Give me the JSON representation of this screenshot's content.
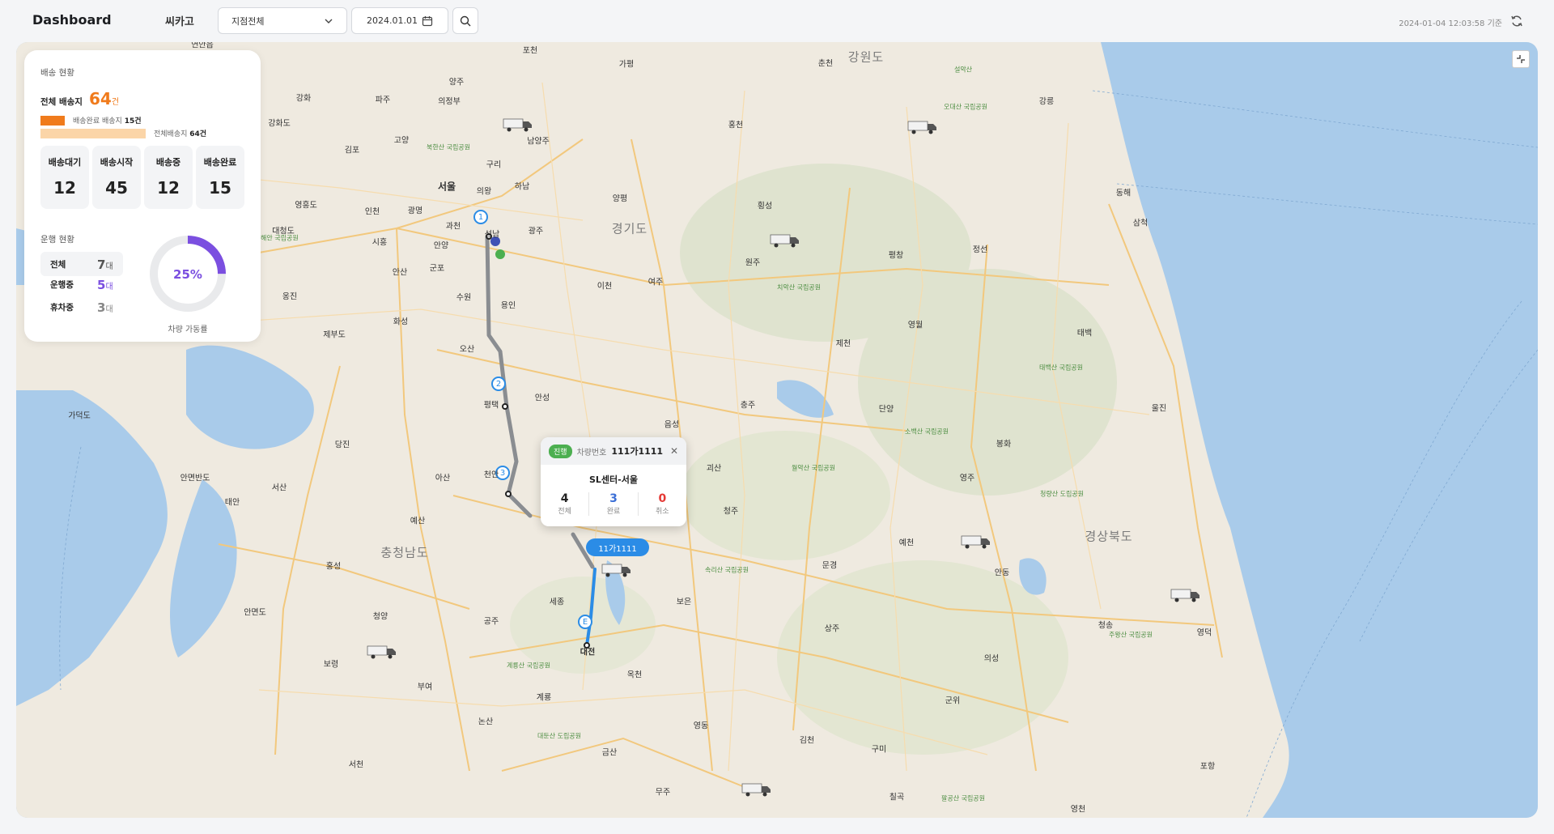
{
  "header": {
    "title": "Dashboard",
    "company": "씨카고",
    "branch_select": "지점전체",
    "date": "2024.01.01",
    "timestamp": "2024-01-04 12:03:58 기준"
  },
  "delivery_status": {
    "title": "배송 현황",
    "total_label": "전체 배송지",
    "total_value": "64",
    "total_unit": "건",
    "done_bar_label": "배송완료 배송지",
    "done_bar_value": "15건",
    "total_bar_label": "전체배송지",
    "total_bar_value": "64건",
    "done_fraction": 0.234,
    "cards": [
      {
        "label": "배송대기",
        "value": "12"
      },
      {
        "label": "배송시작",
        "value": "45"
      },
      {
        "label": "배송중",
        "value": "12"
      },
      {
        "label": "배송완료",
        "value": "15"
      }
    ]
  },
  "operation_status": {
    "title": "운행 현황",
    "rows": [
      {
        "label": "전체",
        "value": "7",
        "unit": "대"
      },
      {
        "label": "운행중",
        "value": "5",
        "unit": "대"
      },
      {
        "label": "휴차중",
        "value": "3",
        "unit": "대"
      }
    ],
    "utilization": "25%",
    "utilization_fraction": 0.25,
    "utilization_label": "차량 가동률"
  },
  "popup": {
    "badge": "진행",
    "vehicle_label": "차량번호",
    "vehicle_no": "111가1111",
    "close": "✕",
    "route": "SL센터-서울",
    "stats": [
      {
        "value": "4",
        "label": "전체",
        "color": "#222222"
      },
      {
        "value": "3",
        "label": "완료",
        "color": "#3b6fd6"
      },
      {
        "value": "0",
        "label": "취소",
        "color": "#e53935"
      }
    ]
  },
  "vehicle_tag": "11가1111",
  "route_markers": [
    "1",
    "2",
    "3",
    "E"
  ],
  "map_labels": {
    "regions": [
      "강원도",
      "경기도",
      "충청남도",
      "경상북도"
    ],
    "cities": [
      "서울",
      "연안읍",
      "포천",
      "가평",
      "양주",
      "의정부",
      "파주",
      "강화",
      "김포",
      "고양",
      "구리",
      "남양주",
      "하남",
      "양평",
      "인천",
      "광명",
      "과천",
      "광주",
      "성남",
      "시흥",
      "안양",
      "군포",
      "안산",
      "수원",
      "용인",
      "이천",
      "여주",
      "화성",
      "오산",
      "평택",
      "안성",
      "아산",
      "천안",
      "당진",
      "서산",
      "태안",
      "예산",
      "홍성",
      "청양",
      "공주",
      "세종",
      "대전",
      "보령",
      "부여",
      "논산",
      "계룡",
      "서천",
      "금산",
      "옥천",
      "보은",
      "영동",
      "무주",
      "청주",
      "음성",
      "충주",
      "괴산",
      "제천",
      "원주",
      "횡성",
      "홍천",
      "춘천",
      "평창",
      "정선",
      "강릉",
      "동해",
      "삼척",
      "태백",
      "영월",
      "단양",
      "봉화",
      "영주",
      "울진",
      "예천",
      "문경",
      "상주",
      "안동",
      "의성",
      "청송",
      "영덕",
      "군위",
      "김천",
      "구미",
      "칠곡",
      "포항",
      "영천",
      "의왕",
      "옹진",
      "제부도",
      "가덕도",
      "안면도",
      "안면반도",
      "강화도",
      "영흥도",
      "대청도"
    ],
    "parks": [
      "북한산 국립공원",
      "오대산 국립공원",
      "설악산",
      "치악산 국립공원",
      "월악산 국립공원",
      "소백산 국립공원",
      "속리산 국립공원",
      "계룡산 국립공원",
      "대둔산 도립공원",
      "태백산 국립공원",
      "청량산 도립공원",
      "주왕산 국립공원",
      "팔공산 국립공원",
      "태안해안 국립공원"
    ]
  }
}
